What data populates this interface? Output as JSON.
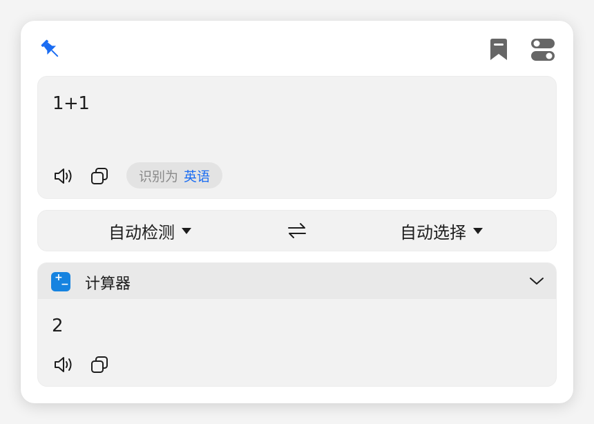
{
  "toolbar": {
    "pin_icon": "pin-icon",
    "bookmark_icon": "bookmark-icon",
    "settings_icon": "toggles-icon",
    "accent_color": "#1a6cf2"
  },
  "input": {
    "text": "1+1",
    "detected_prefix": "识别为",
    "detected_language": "英语"
  },
  "languages": {
    "source": "自动检测",
    "target": "自动选择"
  },
  "result": {
    "service_name": "计算器",
    "service_icon_color": "#1683e0",
    "text": "2"
  }
}
